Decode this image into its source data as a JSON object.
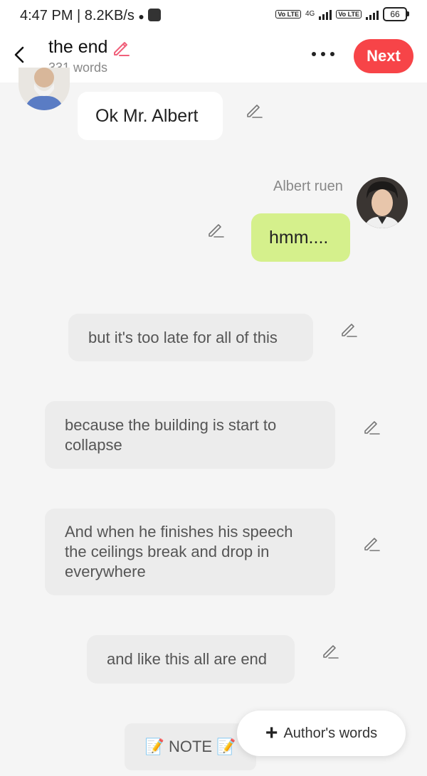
{
  "status_bar": {
    "time": "4:47 PM",
    "speed": "8.2KB/s",
    "sim1_tag": "Vo LTE",
    "network": "4G",
    "sim2_tag": "Vo LTE",
    "battery": "66"
  },
  "header": {
    "title": "the end",
    "word_count": "331 words",
    "next_label": "Next",
    "accent_color": "#f74448"
  },
  "chat": {
    "msg1": "Ok Mr. Albert",
    "speaker2_name": "Albert ruen",
    "msg2": "hmm....",
    "narration1": "but it's too late for all of this",
    "narration2": "because the building is start to collapse",
    "narration3": "And when he finishes his speech the ceilings break and drop in everywhere",
    "narration4": "and like this all are end",
    "note_label": "NOTE",
    "note_emoji": "📝"
  },
  "fab": {
    "label": "Author's words",
    "icon": "plus-icon"
  }
}
